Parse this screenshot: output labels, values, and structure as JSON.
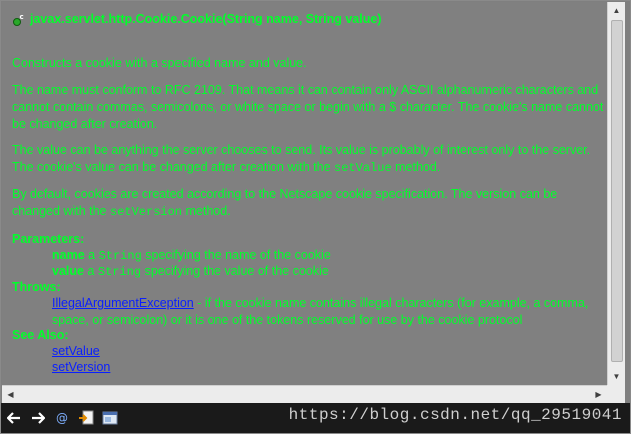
{
  "doc": {
    "title": "javax.servlet.http.Cookie.Cookie(String name, String value)",
    "p1": "Constructs a cookie with a specified name and value.",
    "p2": "The name must conform to RFC 2109. That means it can contain only ASCII alphanumeric characters and cannot contain commas, semicolons, or white space or begin with a $ character. The cookie's name cannot be changed after creation.",
    "p3_a": "The value can be anything the server chooses to send. Its value is probably of interest only to the server. The cookie's value can be changed after creation with the ",
    "p3_code": "setValue",
    "p3_b": " method.",
    "p4_a": "By default, cookies are created according to the Netscape cookie specification. The version can be changed with the ",
    "p4_code": "setVersion",
    "p4_b": " method.",
    "parameters_label": "Parameters:",
    "param1_name": "name",
    "param1_a": " a ",
    "param1_type": "String",
    "param1_b": " specifying the name of the cookie",
    "param2_name": "value",
    "param2_a": " a ",
    "param2_type": "String",
    "param2_b": " specifying the value of the cookie",
    "throws_label": "Throws:",
    "throws_link": "IllegalArgumentException",
    "throws_text": " - if the cookie name contains illegal characters (for example, a comma, space, or semicolon) or it is one of the tokens reserved for use by the cookie protocol",
    "seealso_label": "See Also:",
    "seealso_links": [
      "setValue",
      "setVersion"
    ]
  },
  "toolbar": {
    "icons": [
      "back-arrow-icon",
      "forward-arrow-icon",
      "javadoc-at-icon",
      "open-declaration-icon",
      "open-browser-icon"
    ]
  },
  "watermark": "https://blog.csdn.net/qq_29519041",
  "colors": {
    "doc_bg": "#808080",
    "doc_text": "#00ff2a",
    "link": "#0a1fff",
    "toolbar_bg": "#1a1a1a"
  }
}
